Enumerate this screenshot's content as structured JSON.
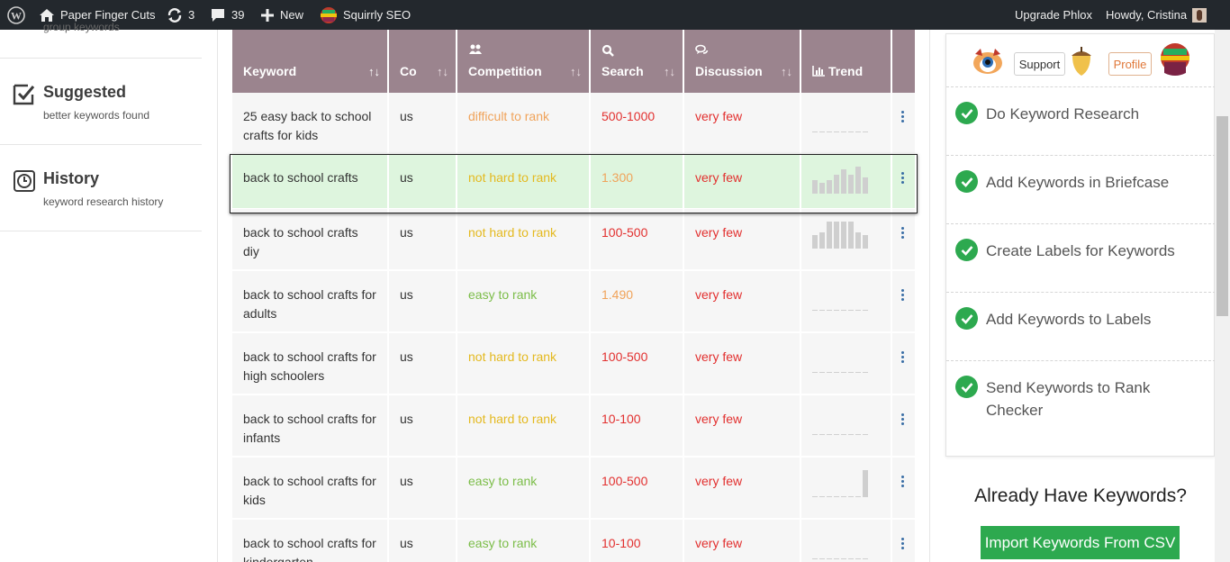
{
  "adminbar": {
    "site_name": "Paper Finger Cuts",
    "updates_count": "3",
    "comments_count": "39",
    "new_label": "New",
    "plugin_label": "Squirrly SEO",
    "upgrade_label": "Upgrade Phlox",
    "howdy_label": "Howdy, Cristina"
  },
  "sidebar": {
    "partial_sub": "group keywords",
    "items": [
      {
        "title": "Suggested",
        "subtitle": "better keywords found",
        "icon": "check-box-icon"
      },
      {
        "title": "History",
        "subtitle": "keyword research history",
        "icon": "clock-icon"
      }
    ]
  },
  "table": {
    "headers": [
      {
        "label": "Keyword",
        "icon": "",
        "sort": "↑↓"
      },
      {
        "label": "Co",
        "icon": "",
        "sort": "↑↓"
      },
      {
        "label": "Competition",
        "icon": "users-icon",
        "sort": "↑↓"
      },
      {
        "label": "Search",
        "icon": "search-icon",
        "sort": "↑↓"
      },
      {
        "label": "Discussion",
        "icon": "comments-icon",
        "sort": "↑↓"
      },
      {
        "label": "Trend",
        "icon": "bar-chart-icon",
        "sort": ""
      }
    ],
    "rows": [
      {
        "keyword": "25 easy back to school crafts for kids",
        "country": "us",
        "competition": "difficult to rank",
        "comp_color": "#f0a35a",
        "search": "500-1000",
        "search_color": "#e2302f",
        "discussion": "very few",
        "trend": [
          0,
          0,
          0,
          0,
          0,
          0,
          0,
          0
        ]
      },
      {
        "keyword": "back to school crafts",
        "country": "us",
        "competition": "not hard to rank",
        "comp_color": "#e4b91f",
        "search": "1.300",
        "search_color": "#f0a35a",
        "discussion": "very few",
        "trend": [
          0.5,
          0.4,
          0.5,
          0.7,
          0.9,
          0.7,
          1.0,
          0.6
        ]
      },
      {
        "keyword": "back to school crafts diy",
        "country": "us",
        "competition": "not hard to rank",
        "comp_color": "#e4b91f",
        "search": "100-500",
        "search_color": "#e2302f",
        "discussion": "very few",
        "trend": [
          0.5,
          0.6,
          1.0,
          1.0,
          1.0,
          1.0,
          0.6,
          0.5
        ]
      },
      {
        "keyword": "back to school crafts for adults",
        "country": "us",
        "competition": "easy to rank",
        "comp_color": "#7cbd49",
        "search": "1.490",
        "search_color": "#f0a35a",
        "discussion": "very few",
        "trend": [
          0,
          0,
          0,
          0,
          0,
          0,
          0,
          0
        ]
      },
      {
        "keyword": "back to school crafts for high schoolers",
        "country": "us",
        "competition": "not hard to rank",
        "comp_color": "#e4b91f",
        "search": "100-500",
        "search_color": "#e2302f",
        "discussion": "very few",
        "trend": [
          0,
          0,
          0,
          0,
          0,
          0,
          0,
          0
        ]
      },
      {
        "keyword": "back to school crafts for infants",
        "country": "us",
        "competition": "not hard to rank",
        "comp_color": "#e4b91f",
        "search": "10-100",
        "search_color": "#e2302f",
        "discussion": "very few",
        "trend": [
          0,
          0,
          0,
          0,
          0,
          0,
          0,
          0
        ]
      },
      {
        "keyword": "back to school crafts for kids",
        "country": "us",
        "competition": "easy to rank",
        "comp_color": "#7cbd49",
        "search": "100-500",
        "search_color": "#e2302f",
        "discussion": "very few",
        "trend": [
          0,
          0,
          0,
          0,
          0,
          0,
          0,
          1.0
        ]
      },
      {
        "keyword": "back to school crafts for kindergarten",
        "country": "us",
        "competition": "easy to rank",
        "comp_color": "#7cbd49",
        "search": "10-100",
        "search_color": "#e2302f",
        "discussion": "very few",
        "trend": [
          0,
          0,
          0,
          0,
          0,
          0,
          0,
          0
        ]
      }
    ]
  },
  "rightpanel": {
    "support_label": "Support",
    "profile_label": "Profile",
    "tasks": [
      "Do Keyword Research",
      "Add Keywords in Briefcase",
      "Create Labels for Keywords",
      "Add Keywords to Labels",
      "Send Keywords to Rank Checker"
    ],
    "already_title": "Already Have Keywords?",
    "import_label": "Import Keywords From CSV"
  },
  "colors": {
    "header_bg": "#9b848e",
    "highlight_bg": "#def5de",
    "green": "#2da94f",
    "red": "#e2302f"
  }
}
